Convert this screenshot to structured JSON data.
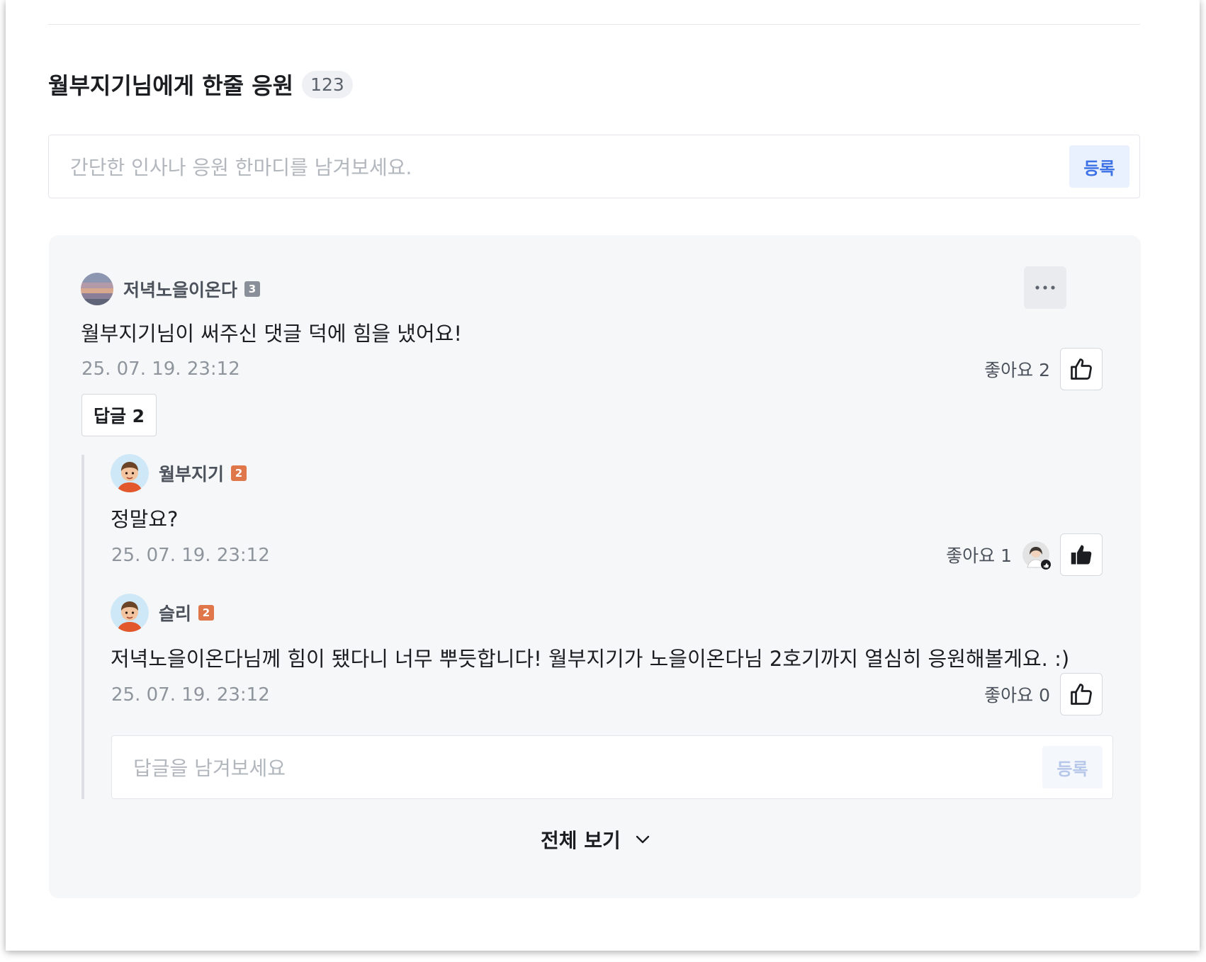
{
  "section": {
    "title": "월부지기님에게 한줄 응원",
    "count": "123",
    "input_placeholder": "간단한 인사나 응원 한마디를 남겨보세요.",
    "submit_label": "등록"
  },
  "comment": {
    "author": "저녁노을이온다",
    "level": "3",
    "text": "월부지기님이 써주신 댓글 덕에 힘을 냈어요!",
    "timestamp": "25. 07. 19. 23:12",
    "like_label": "좋아요 2",
    "reply_toggle_label": "답글 2"
  },
  "replies": [
    {
      "author": "월부지기",
      "level": "2",
      "text": "정말요?",
      "timestamp": "25. 07. 19. 23:12",
      "like_label": "좋아요 1",
      "liked": true
    },
    {
      "author": "슬리",
      "level": "2",
      "text": "저녁노을이온다님께 힘이 됐다니 너무 뿌듯합니다! 월부지기가 노을이온다님 2호기까지 열심히 응원해볼게요. :)",
      "timestamp": "25. 07. 19. 23:12",
      "like_label": "좋아요 0",
      "liked": false
    }
  ],
  "reply_input": {
    "placeholder": "답글을 남겨보세요",
    "submit_label": "등록"
  },
  "view_all_label": "전체 보기",
  "colors": {
    "accent": "#3d72e6",
    "panel_bg": "#f6f7f9",
    "level_gray": "#8a909a",
    "level_orange": "#e0774a"
  }
}
